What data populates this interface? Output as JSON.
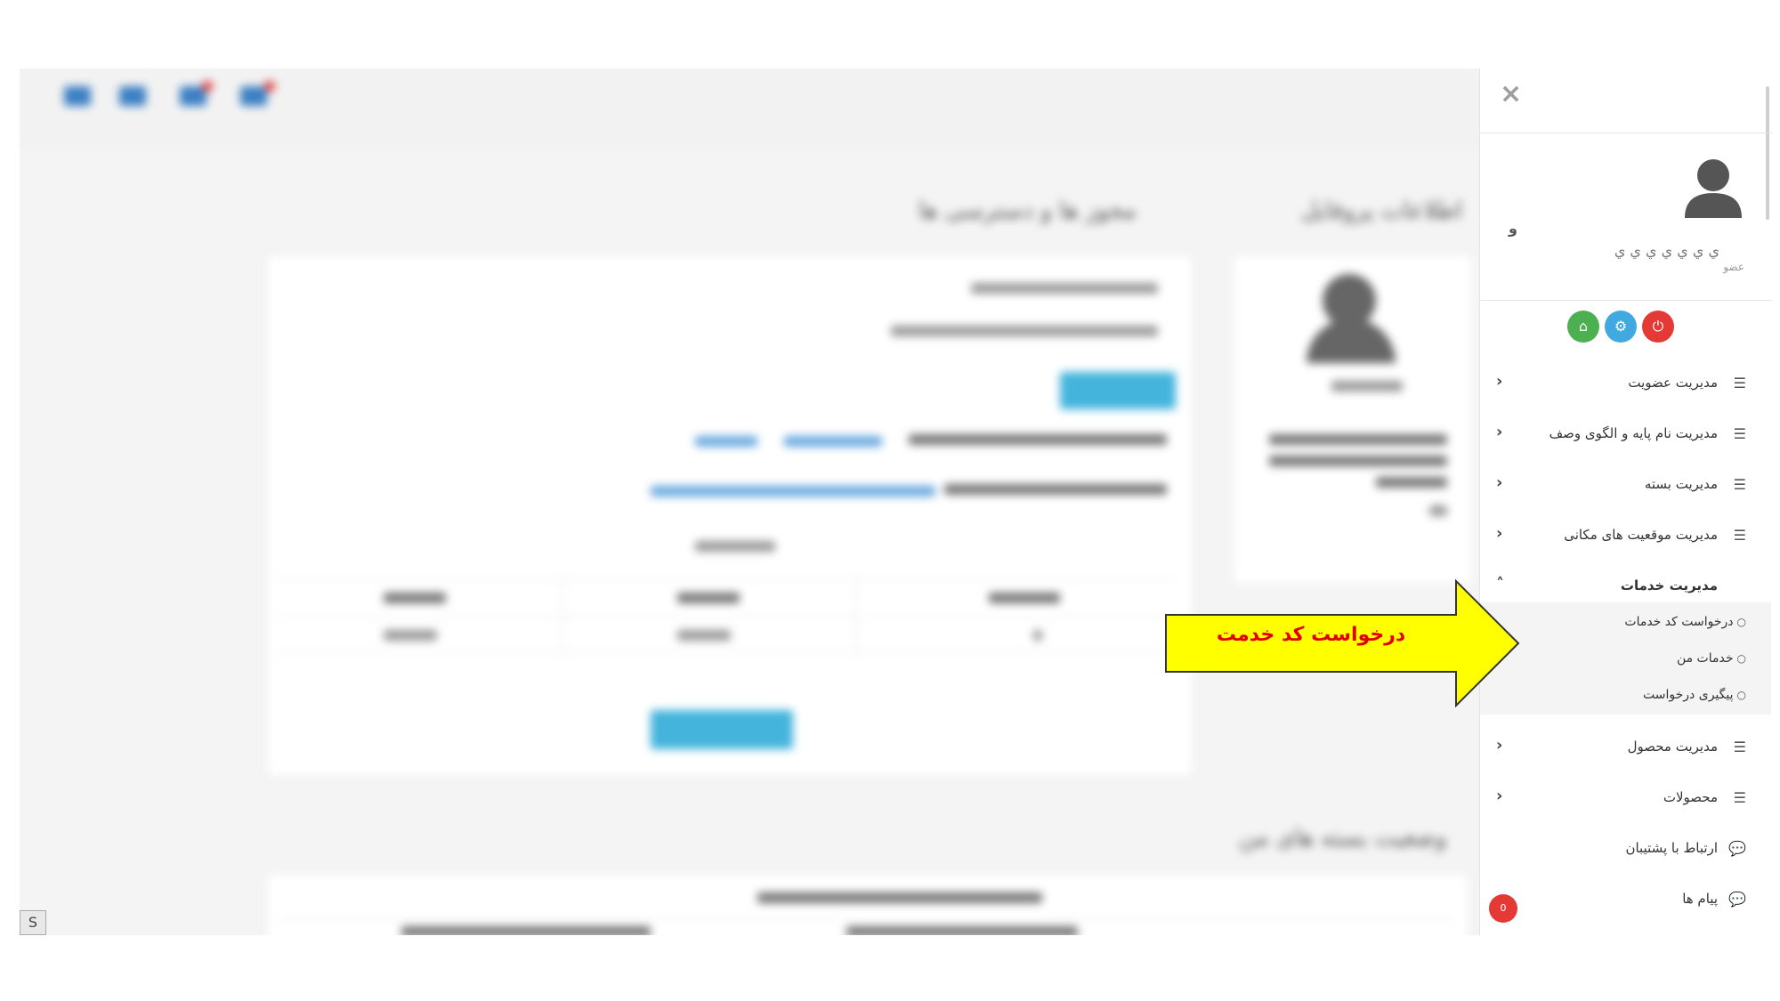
{
  "sidebar": {
    "close_icon": "close-icon",
    "user": {
      "name": "ي ي ي ي ي ي ي",
      "role": "عضو",
      "extra_char": "و"
    },
    "quick_buttons": [
      {
        "name": "home",
        "icon": "home-icon",
        "color": "#4caf50",
        "glyph": "⌂"
      },
      {
        "name": "settings",
        "icon": "gear-icon",
        "color": "#3fa9e0",
        "glyph": "⚙"
      },
      {
        "name": "power",
        "icon": "power-icon",
        "color": "#e53935",
        "glyph": "⏻"
      }
    ],
    "menu": [
      {
        "label": "مدیریت عضویت",
        "icon": "list-icon",
        "chevron": "‹"
      },
      {
        "label": "مدیریت نام پایه و الگوی وصف",
        "icon": "list-icon",
        "chevron": "‹"
      },
      {
        "label": "مدیریت بسته",
        "icon": "list-icon",
        "chevron": "‹"
      },
      {
        "label": "مدیریت موقعیت های مکانی",
        "icon": "list-icon",
        "chevron": "‹"
      },
      {
        "label": "مدیریت خدمات",
        "icon": "list-icon",
        "chevron": "˄",
        "expanded": true
      },
      {
        "label": "مدیریت محصول",
        "icon": "list-icon",
        "chevron": "‹"
      },
      {
        "label": "محصولات",
        "icon": "list-icon",
        "chevron": "‹"
      },
      {
        "label": "ارتباط با پشتیبان",
        "icon": "chat-icon"
      },
      {
        "label": "پیام ها",
        "icon": "chat-icon"
      }
    ],
    "submenu": [
      {
        "label": "درخواست کد خدمات"
      },
      {
        "label": "خدمات من"
      },
      {
        "label": "پیگیری درخواست"
      }
    ],
    "messages_badge": "0"
  },
  "callout": {
    "text": "درخواست کد خدمت",
    "fill": "#ffff00",
    "text_color": "#e00000"
  },
  "background": {
    "section_left_title": "مجوز ها و دسترسی ها",
    "section_right_title": "اطلاعات پروفایل",
    "section_bottom_title": "وضعیت بسته های من"
  },
  "misc": {
    "s_badge": "S"
  }
}
